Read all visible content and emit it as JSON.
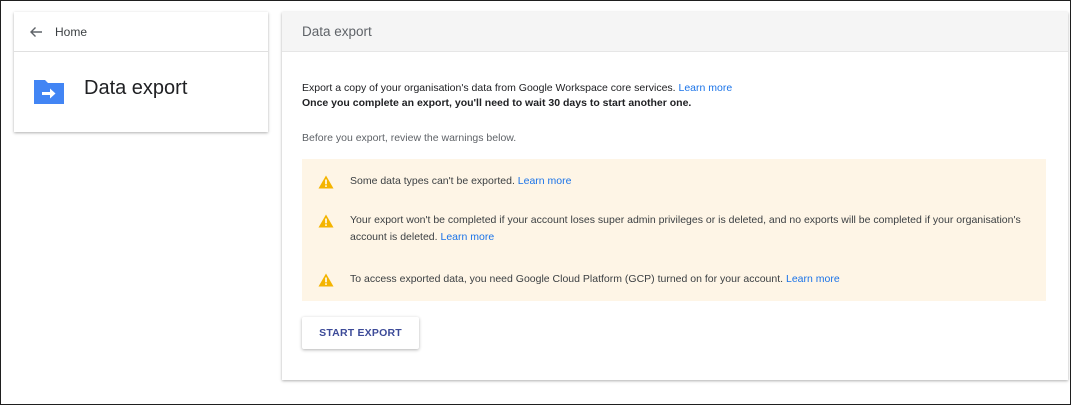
{
  "nav": {
    "back_label": "Home"
  },
  "app": {
    "title": "Data export"
  },
  "main": {
    "header_title": "Data export",
    "intro_line1": "Export a copy of your organisation's data from Google Workspace core services.",
    "intro_link": "Learn more",
    "intro_line2": "Once you complete an export, you'll need to wait 30 days to start another one.",
    "review_text": "Before you export, review the warnings below.",
    "warnings": [
      {
        "text": "Some data types can't be exported.",
        "link": "Learn more"
      },
      {
        "text": "Your export won't be completed if your account loses super admin privileges or is deleted, and no exports will be completed if your organisation's account is deleted.",
        "link": "Learn more"
      },
      {
        "text": "To access exported data, you need Google Cloud Platform (GCP) turned on for your account.",
        "link": "Learn more"
      }
    ],
    "start_button": "START EXPORT"
  },
  "colors": {
    "link": "#1a73e8",
    "warning_bg": "#fef5e6",
    "warning_icon": "#f4b400",
    "folder_icon": "#4285f4",
    "button_text": "#3c4a98"
  }
}
